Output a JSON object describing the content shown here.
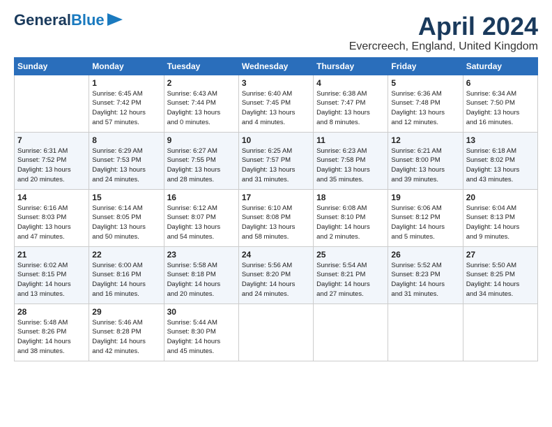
{
  "logo": {
    "line1": "General",
    "line2": "Blue"
  },
  "title": "April 2024",
  "location": "Evercreech, England, United Kingdom",
  "weekdays": [
    "Sunday",
    "Monday",
    "Tuesday",
    "Wednesday",
    "Thursday",
    "Friday",
    "Saturday"
  ],
  "weeks": [
    [
      {
        "day": "",
        "info": ""
      },
      {
        "day": "1",
        "info": "Sunrise: 6:45 AM\nSunset: 7:42 PM\nDaylight: 12 hours\nand 57 minutes."
      },
      {
        "day": "2",
        "info": "Sunrise: 6:43 AM\nSunset: 7:44 PM\nDaylight: 13 hours\nand 0 minutes."
      },
      {
        "day": "3",
        "info": "Sunrise: 6:40 AM\nSunset: 7:45 PM\nDaylight: 13 hours\nand 4 minutes."
      },
      {
        "day": "4",
        "info": "Sunrise: 6:38 AM\nSunset: 7:47 PM\nDaylight: 13 hours\nand 8 minutes."
      },
      {
        "day": "5",
        "info": "Sunrise: 6:36 AM\nSunset: 7:48 PM\nDaylight: 13 hours\nand 12 minutes."
      },
      {
        "day": "6",
        "info": "Sunrise: 6:34 AM\nSunset: 7:50 PM\nDaylight: 13 hours\nand 16 minutes."
      }
    ],
    [
      {
        "day": "7",
        "info": "Sunrise: 6:31 AM\nSunset: 7:52 PM\nDaylight: 13 hours\nand 20 minutes."
      },
      {
        "day": "8",
        "info": "Sunrise: 6:29 AM\nSunset: 7:53 PM\nDaylight: 13 hours\nand 24 minutes."
      },
      {
        "day": "9",
        "info": "Sunrise: 6:27 AM\nSunset: 7:55 PM\nDaylight: 13 hours\nand 28 minutes."
      },
      {
        "day": "10",
        "info": "Sunrise: 6:25 AM\nSunset: 7:57 PM\nDaylight: 13 hours\nand 31 minutes."
      },
      {
        "day": "11",
        "info": "Sunrise: 6:23 AM\nSunset: 7:58 PM\nDaylight: 13 hours\nand 35 minutes."
      },
      {
        "day": "12",
        "info": "Sunrise: 6:21 AM\nSunset: 8:00 PM\nDaylight: 13 hours\nand 39 minutes."
      },
      {
        "day": "13",
        "info": "Sunrise: 6:18 AM\nSunset: 8:02 PM\nDaylight: 13 hours\nand 43 minutes."
      }
    ],
    [
      {
        "day": "14",
        "info": "Sunrise: 6:16 AM\nSunset: 8:03 PM\nDaylight: 13 hours\nand 47 minutes."
      },
      {
        "day": "15",
        "info": "Sunrise: 6:14 AM\nSunset: 8:05 PM\nDaylight: 13 hours\nand 50 minutes."
      },
      {
        "day": "16",
        "info": "Sunrise: 6:12 AM\nSunset: 8:07 PM\nDaylight: 13 hours\nand 54 minutes."
      },
      {
        "day": "17",
        "info": "Sunrise: 6:10 AM\nSunset: 8:08 PM\nDaylight: 13 hours\nand 58 minutes."
      },
      {
        "day": "18",
        "info": "Sunrise: 6:08 AM\nSunset: 8:10 PM\nDaylight: 14 hours\nand 2 minutes."
      },
      {
        "day": "19",
        "info": "Sunrise: 6:06 AM\nSunset: 8:12 PM\nDaylight: 14 hours\nand 5 minutes."
      },
      {
        "day": "20",
        "info": "Sunrise: 6:04 AM\nSunset: 8:13 PM\nDaylight: 14 hours\nand 9 minutes."
      }
    ],
    [
      {
        "day": "21",
        "info": "Sunrise: 6:02 AM\nSunset: 8:15 PM\nDaylight: 14 hours\nand 13 minutes."
      },
      {
        "day": "22",
        "info": "Sunrise: 6:00 AM\nSunset: 8:16 PM\nDaylight: 14 hours\nand 16 minutes."
      },
      {
        "day": "23",
        "info": "Sunrise: 5:58 AM\nSunset: 8:18 PM\nDaylight: 14 hours\nand 20 minutes."
      },
      {
        "day": "24",
        "info": "Sunrise: 5:56 AM\nSunset: 8:20 PM\nDaylight: 14 hours\nand 24 minutes."
      },
      {
        "day": "25",
        "info": "Sunrise: 5:54 AM\nSunset: 8:21 PM\nDaylight: 14 hours\nand 27 minutes."
      },
      {
        "day": "26",
        "info": "Sunrise: 5:52 AM\nSunset: 8:23 PM\nDaylight: 14 hours\nand 31 minutes."
      },
      {
        "day": "27",
        "info": "Sunrise: 5:50 AM\nSunset: 8:25 PM\nDaylight: 14 hours\nand 34 minutes."
      }
    ],
    [
      {
        "day": "28",
        "info": "Sunrise: 5:48 AM\nSunset: 8:26 PM\nDaylight: 14 hours\nand 38 minutes."
      },
      {
        "day": "29",
        "info": "Sunrise: 5:46 AM\nSunset: 8:28 PM\nDaylight: 14 hours\nand 42 minutes."
      },
      {
        "day": "30",
        "info": "Sunrise: 5:44 AM\nSunset: 8:30 PM\nDaylight: 14 hours\nand 45 minutes."
      },
      {
        "day": "",
        "info": ""
      },
      {
        "day": "",
        "info": ""
      },
      {
        "day": "",
        "info": ""
      },
      {
        "day": "",
        "info": ""
      }
    ]
  ]
}
